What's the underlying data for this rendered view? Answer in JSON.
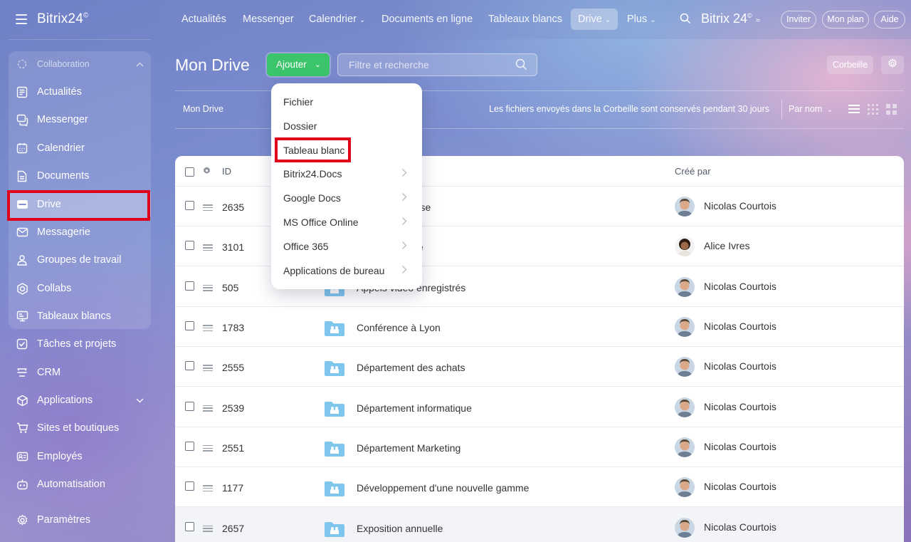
{
  "app": {
    "logo": "Bitrix24",
    "logo_mark": "©"
  },
  "sidebar": {
    "group_label": "Collaboration",
    "items": [
      {
        "label": "Actualités",
        "icon": "newsfeed-icon"
      },
      {
        "label": "Messenger",
        "icon": "chat-icon"
      },
      {
        "label": "Calendrier",
        "icon": "calendar-icon"
      },
      {
        "label": "Documents",
        "icon": "document-icon"
      },
      {
        "label": "Drive",
        "icon": "drive-icon",
        "active": true
      },
      {
        "label": "Messagerie",
        "icon": "mail-icon"
      },
      {
        "label": "Groupes de travail",
        "icon": "group-icon"
      },
      {
        "label": "Collabs",
        "icon": "collab-icon"
      },
      {
        "label": "Tableaux blancs",
        "icon": "whiteboard-icon"
      },
      {
        "label": "Tâches et projets",
        "icon": "task-icon"
      },
      {
        "label": "CRM",
        "icon": "crm-icon"
      },
      {
        "label": "Applications",
        "icon": "apps-icon"
      },
      {
        "label": "Sites et boutiques",
        "icon": "cart-icon"
      },
      {
        "label": "Employés",
        "icon": "employees-icon"
      },
      {
        "label": "Automatisation",
        "icon": "robot-icon"
      },
      {
        "label": "Paramètres",
        "icon": "gear-icon"
      }
    ]
  },
  "topnav": {
    "items": [
      "Actualités",
      "Messenger",
      "Calendrier",
      "Documents en ligne",
      "Tableaux blancs",
      "Drive",
      "Plus"
    ],
    "brand": "Bitrix 24",
    "invite": "Inviter",
    "plan": "Mon plan",
    "help": "Aide"
  },
  "header": {
    "title": "Mon Drive",
    "add_label": "Ajouter",
    "filter_placeholder": "Filtre et recherche",
    "trash_label": "Corbeille"
  },
  "toolbar": {
    "breadcrumb": "Mon Drive",
    "retention_note": "Les fichiers envoyés dans la Corbeille sont conservés pendant 30 jours",
    "sort_label": "Par nom"
  },
  "grid": {
    "columns": {
      "id": "ID",
      "author": "Créé par"
    },
    "rows": [
      {
        "id": "2635",
        "name": "…otre entreprise",
        "author": "Nicolas Courtois",
        "avatar": "male"
      },
      {
        "id": "3101",
        "name": "…e l'entreprise",
        "author": "Alice Ivres",
        "avatar": "female"
      },
      {
        "id": "505",
        "name": "Appels vidéo enregistrés",
        "author": "Nicolas Courtois",
        "avatar": "male"
      },
      {
        "id": "1783",
        "name": "Conférence à Lyon",
        "author": "Nicolas Courtois",
        "avatar": "male"
      },
      {
        "id": "2555",
        "name": "Département des achats",
        "author": "Nicolas Courtois",
        "avatar": "male"
      },
      {
        "id": "2539",
        "name": "Département informatique",
        "author": "Nicolas Courtois",
        "avatar": "male"
      },
      {
        "id": "2551",
        "name": "Département Marketing",
        "author": "Nicolas Courtois",
        "avatar": "male"
      },
      {
        "id": "1177",
        "name": "Développement d'une nouvelle gamme",
        "author": "Nicolas Courtois",
        "avatar": "male"
      },
      {
        "id": "2657",
        "name": "Exposition annuelle",
        "author": "Nicolas Courtois",
        "avatar": "male"
      }
    ]
  },
  "add_menu": {
    "items": [
      {
        "label": "Fichier",
        "submenu": false
      },
      {
        "label": "Dossier",
        "submenu": false
      },
      {
        "label": "Tableau blanc",
        "submenu": false
      },
      {
        "label": "Bitrix24.Docs",
        "submenu": true
      },
      {
        "label": "Google Docs",
        "submenu": true
      },
      {
        "label": "MS Office Online",
        "submenu": true
      },
      {
        "label": "Office 365",
        "submenu": true
      },
      {
        "label": "Applications de bureau",
        "submenu": true
      }
    ]
  },
  "colors": {
    "accent_green": "#3bc46a",
    "highlight_red": "#e0001b",
    "folder_blue": "#7fc6ee"
  }
}
